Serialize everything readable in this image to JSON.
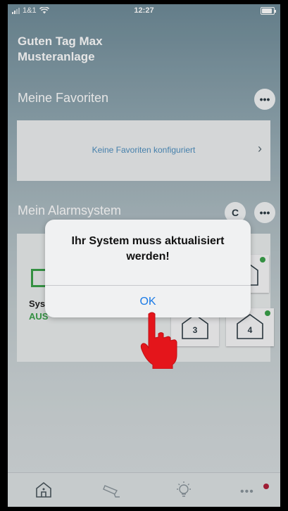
{
  "status_bar": {
    "carrier": "1&1",
    "time": "12:27"
  },
  "header": {
    "greeting": "Guten Tag Max",
    "installation": "Musteranlage"
  },
  "favorites": {
    "title": "Meine Favoriten",
    "more_label": "•••",
    "empty_text": "Keine Favoriten konfiguriert",
    "chevron": "›"
  },
  "alarm": {
    "title": "Mein Alarmsystem",
    "refresh_label": "C",
    "more_label": "•••",
    "system_name": "Sys",
    "system_state": "AUS",
    "zones": [
      {
        "label": "3"
      },
      {
        "label": "4"
      }
    ]
  },
  "dialog": {
    "message": "Ihr System muss aktualisiert werden!",
    "ok_label": "OK"
  },
  "tabbar": {
    "items": [
      "home-icon",
      "camera-icon",
      "light-icon",
      "more-icon"
    ],
    "more_label": "•••"
  },
  "colors": {
    "accent": "#1a7ae6",
    "status_green": "#3aa14a",
    "badge": "#b0213a"
  }
}
